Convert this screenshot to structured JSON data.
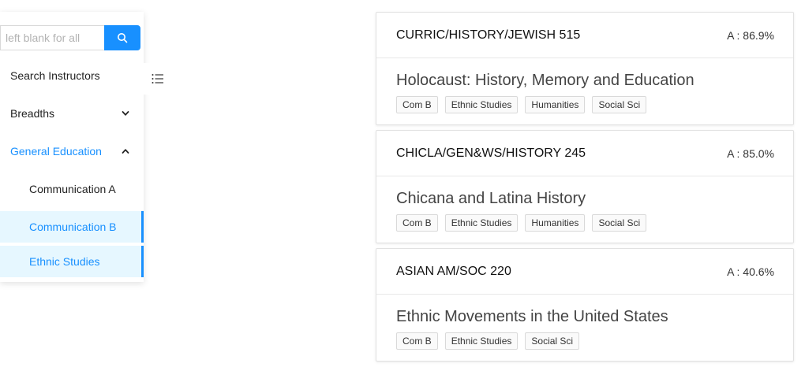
{
  "search": {
    "placeholder": "left blank for all"
  },
  "menu": {
    "search_instructors": "Search Instructors",
    "breadths": "Breadths",
    "general_education": "General Education",
    "communication_a": "Communication A",
    "communication_b": "Communication B",
    "ethnic_studies": "Ethnic Studies"
  },
  "colors": {
    "accent": "#1890ff",
    "selected_bg": "#e6f7ff"
  },
  "courses": [
    {
      "code": "CURRIC/HISTORY/JEWISH 515",
      "grade": "A : 86.9%",
      "title": "Holocaust: History, Memory and Education",
      "tags": [
        "Com B",
        "Ethnic Studies",
        "Humanities",
        "Social Sci"
      ]
    },
    {
      "code": "CHICLA/GEN&WS/HISTORY 245",
      "grade": "A : 85.0%",
      "title": "Chicana and Latina History",
      "tags": [
        "Com B",
        "Ethnic Studies",
        "Humanities",
        "Social Sci"
      ]
    },
    {
      "code": "ASIAN AM/SOC 220",
      "grade": "A : 40.6%",
      "title": "Ethnic Movements in the United States",
      "tags": [
        "Com B",
        "Ethnic Studies",
        "Social Sci"
      ]
    }
  ]
}
